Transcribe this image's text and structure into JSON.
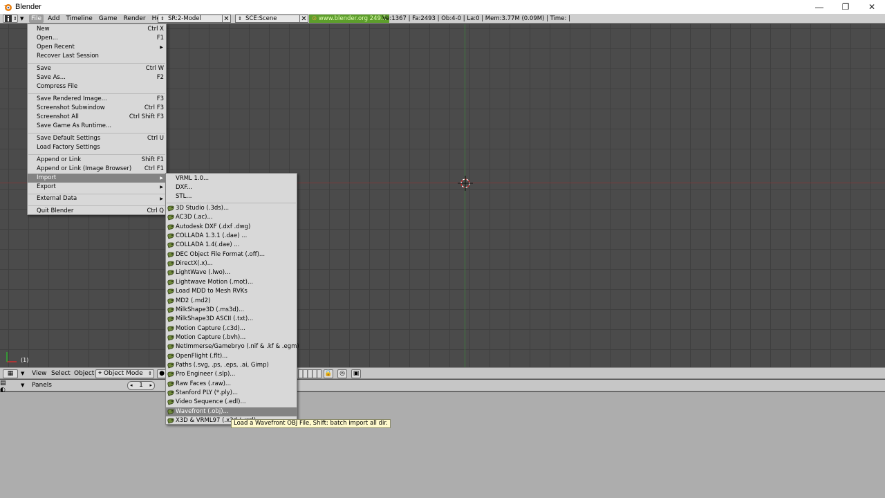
{
  "window": {
    "title": "Blender",
    "controls": [
      "—",
      "❐",
      "✕"
    ]
  },
  "topbar": {
    "menus": [
      "File",
      "Add",
      "Timeline",
      "Game",
      "Render",
      "Help"
    ],
    "screen_field": "SR:2-Model",
    "scene_field": "SCE:Scene",
    "site": "www.blender.org 249.2",
    "stats": "Ve:1367 | Fa:2493 | Ob:4-0 | La:0  | Mem:3.77M (0.09M)  | Time: |"
  },
  "file_menu": {
    "items": [
      {
        "label": "New",
        "shortcut": "Ctrl X"
      },
      {
        "label": "Open...",
        "shortcut": "F1"
      },
      {
        "label": "Open Recent",
        "shortcut": "",
        "submenu": true
      },
      {
        "label": "Recover Last Session",
        "shortcut": ""
      },
      {
        "label": "Save",
        "shortcut": "Ctrl W"
      },
      {
        "label": "Save As...",
        "shortcut": "F2"
      },
      {
        "label": "Compress File",
        "shortcut": ""
      },
      {
        "label": "Save Rendered Image...",
        "shortcut": "F3"
      },
      {
        "label": "Screenshot Subwindow",
        "shortcut": "Ctrl F3"
      },
      {
        "label": "Screenshot All",
        "shortcut": "Ctrl Shift F3"
      },
      {
        "label": "Save Game As Runtime...",
        "shortcut": ""
      },
      {
        "label": "Save Default Settings",
        "shortcut": "Ctrl U"
      },
      {
        "label": "Load Factory Settings",
        "shortcut": ""
      },
      {
        "label": "Append or Link",
        "shortcut": "Shift F1"
      },
      {
        "label": "Append or Link (Image Browser)",
        "shortcut": "Ctrl F1"
      },
      {
        "label": "Import",
        "shortcut": "",
        "submenu": true
      },
      {
        "label": "Export",
        "shortcut": "",
        "submenu": true
      },
      {
        "label": "External Data",
        "shortcut": "",
        "submenu": true
      },
      {
        "label": "Quit Blender",
        "shortcut": "Ctrl Q"
      }
    ]
  },
  "import_menu": {
    "items": [
      "VRML 1.0...",
      "DXF...",
      "STL...",
      "3D Studio (.3ds)...",
      "AC3D (.ac)...",
      "Autodesk DXF (.dxf .dwg)",
      "COLLADA 1.3.1 (.dae) ...",
      "COLLADA 1.4(.dae) ...",
      "DEC Object File Format (.off)...",
      "DirectX(.x)...",
      "LightWave (.lwo)...",
      "Lightwave Motion (.mot)...",
      "Load MDD to Mesh RVKs",
      "MD2 (.md2)",
      "MilkShape3D (.ms3d)...",
      "MilkShape3D ASCII (.txt)...",
      "Motion Capture  (.c3d)...",
      "Motion Capture (.bvh)...",
      "NetImmerse/Gamebryo (.nif & .kf & .egm)",
      "OpenFlight (.flt)...",
      "Paths (.svg, .ps, .eps, .ai, Gimp)",
      "Pro Engineer (.slp)...",
      "Raw Faces (.raw)...",
      "Stanford PLY (*.ply)...",
      "Video Sequence (.edl)...",
      "Wavefront (.obj)...",
      "X3D & VRML97 (.x3d / .wrl)..."
    ]
  },
  "tooltip": "Load a Wavefront OBJ File, Shift: batch import all dir.",
  "viewport": {
    "frame_label": "(1)"
  },
  "view_header": {
    "menus": [
      "View",
      "Select",
      "Object"
    ],
    "mode": "Object Mode"
  },
  "buttons_header": {
    "panels_label": "Panels",
    "page_number": "1"
  },
  "colors": {
    "menu_bg": "#d8d8d8",
    "menu_highlight": "#838383",
    "viewport_bg": "#4b4b4b",
    "header_bg": "#cfcfcf",
    "site_badge": "#5d9e2c",
    "tooltip_bg": "#fffacd"
  }
}
